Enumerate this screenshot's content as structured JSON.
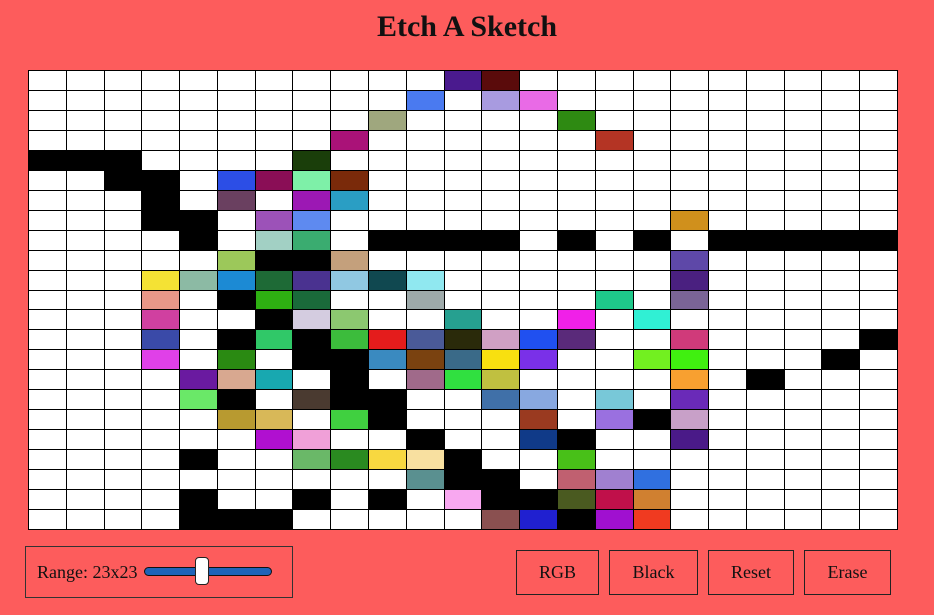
{
  "title": "Etch A Sketch",
  "range": {
    "label": "Range: 23x23",
    "value": 23,
    "min": 1,
    "max": 50
  },
  "buttons": {
    "rgb": "RGB",
    "black": "Black",
    "reset": "Reset",
    "erase": "Erase"
  },
  "grid": {
    "size": 23,
    "painted_cells": [
      [
        0,
        11,
        "#4a1a8e"
      ],
      [
        0,
        12,
        "#5a0b0b"
      ],
      [
        1,
        10,
        "#4a7af0"
      ],
      [
        1,
        12,
        "#a89be0"
      ],
      [
        1,
        13,
        "#e96ae6"
      ],
      [
        2,
        9,
        "#9fa77e"
      ],
      [
        2,
        14,
        "#2e8a12"
      ],
      [
        3,
        8,
        "#aa1278"
      ],
      [
        3,
        15,
        "#b43424"
      ],
      [
        4,
        0,
        "#000000"
      ],
      [
        4,
        1,
        "#000000"
      ],
      [
        4,
        2,
        "#000000"
      ],
      [
        4,
        7,
        "#1a3e0a"
      ],
      [
        5,
        2,
        "#000000"
      ],
      [
        5,
        3,
        "#000000"
      ],
      [
        5,
        5,
        "#2c4ee6"
      ],
      [
        5,
        6,
        "#8a0e56"
      ],
      [
        5,
        7,
        "#7ef0a8"
      ],
      [
        5,
        8,
        "#7a2a0a"
      ],
      [
        6,
        3,
        "#000000"
      ],
      [
        6,
        5,
        "#6a4060"
      ],
      [
        6,
        7,
        "#9c18b4"
      ],
      [
        6,
        8,
        "#2a9ec4"
      ],
      [
        7,
        3,
        "#000000"
      ],
      [
        7,
        4,
        "#000000"
      ],
      [
        7,
        6,
        "#9c52b8"
      ],
      [
        7,
        7,
        "#5e8af0"
      ],
      [
        7,
        17,
        "#d0901c"
      ],
      [
        8,
        4,
        "#000000"
      ],
      [
        8,
        6,
        "#a2d0c4"
      ],
      [
        8,
        7,
        "#3aac70"
      ],
      [
        8,
        9,
        "#000000"
      ],
      [
        8,
        10,
        "#000000"
      ],
      [
        8,
        11,
        "#000000"
      ],
      [
        8,
        12,
        "#000000"
      ],
      [
        8,
        14,
        "#000000"
      ],
      [
        8,
        16,
        "#000000"
      ],
      [
        8,
        18,
        "#000000"
      ],
      [
        8,
        19,
        "#000000"
      ],
      [
        8,
        20,
        "#000000"
      ],
      [
        8,
        21,
        "#000000"
      ],
      [
        8,
        22,
        "#000000"
      ],
      [
        9,
        5,
        "#9cc85a"
      ],
      [
        9,
        6,
        "#000000"
      ],
      [
        9,
        7,
        "#000000"
      ],
      [
        9,
        8,
        "#c4a07c"
      ],
      [
        9,
        17,
        "#5e48a8"
      ],
      [
        10,
        3,
        "#f4e234"
      ],
      [
        10,
        4,
        "#8cbaa4"
      ],
      [
        10,
        5,
        "#1c8ad4"
      ],
      [
        10,
        6,
        "#1e6a36"
      ],
      [
        10,
        7,
        "#4a3290"
      ],
      [
        10,
        8,
        "#90c8e2"
      ],
      [
        10,
        9,
        "#104850"
      ],
      [
        10,
        10,
        "#90e8f0"
      ],
      [
        10,
        17,
        "#4a2080"
      ],
      [
        11,
        3,
        "#e89888"
      ],
      [
        11,
        5,
        "#000000"
      ],
      [
        11,
        6,
        "#2eb012"
      ],
      [
        11,
        7,
        "#1a6a3a"
      ],
      [
        11,
        10,
        "#9eaaaa"
      ],
      [
        11,
        15,
        "#1ec88a"
      ],
      [
        11,
        17,
        "#7a6496"
      ],
      [
        12,
        3,
        "#d040a0"
      ],
      [
        12,
        6,
        "#000000"
      ],
      [
        12,
        7,
        "#d4cce0"
      ],
      [
        12,
        8,
        "#8cc870"
      ],
      [
        12,
        11,
        "#26a090"
      ],
      [
        12,
        14,
        "#f020e8"
      ],
      [
        12,
        16,
        "#30f0d4"
      ],
      [
        13,
        3,
        "#3a4aa8"
      ],
      [
        13,
        5,
        "#000000"
      ],
      [
        13,
        6,
        "#30c868"
      ],
      [
        13,
        7,
        "#000000"
      ],
      [
        13,
        8,
        "#3cbc3c"
      ],
      [
        13,
        9,
        "#e41c1c"
      ],
      [
        13,
        10,
        "#4a5a98"
      ],
      [
        13,
        11,
        "#2a2a0a"
      ],
      [
        13,
        12,
        "#d0a0c4"
      ],
      [
        13,
        13,
        "#2050f0"
      ],
      [
        13,
        14,
        "#5a2a7a"
      ],
      [
        13,
        17,
        "#d03a7a"
      ],
      [
        13,
        22,
        "#000000"
      ],
      [
        14,
        3,
        "#e040e8"
      ],
      [
        14,
        5,
        "#2a8a12"
      ],
      [
        14,
        7,
        "#000000"
      ],
      [
        14,
        8,
        "#000000"
      ],
      [
        14,
        9,
        "#3a8ac0"
      ],
      [
        14,
        10,
        "#7a4210"
      ],
      [
        14,
        11,
        "#3a6a88"
      ],
      [
        14,
        12,
        "#f8e010"
      ],
      [
        14,
        13,
        "#7a30e8"
      ],
      [
        14,
        16,
        "#72f020"
      ],
      [
        14,
        17,
        "#40f010"
      ],
      [
        14,
        21,
        "#000000"
      ],
      [
        15,
        4,
        "#6a1aa0"
      ],
      [
        15,
        5,
        "#d8a890"
      ],
      [
        15,
        6,
        "#18a8b0"
      ],
      [
        15,
        8,
        "#000000"
      ],
      [
        15,
        10,
        "#a06a8a"
      ],
      [
        15,
        11,
        "#30e040"
      ],
      [
        15,
        12,
        "#c0c040"
      ],
      [
        15,
        17,
        "#f8a030"
      ],
      [
        15,
        19,
        "#000000"
      ],
      [
        16,
        4,
        "#6ae868"
      ],
      [
        16,
        5,
        "#000000"
      ],
      [
        16,
        7,
        "#4a3a30"
      ],
      [
        16,
        8,
        "#000000"
      ],
      [
        16,
        9,
        "#000000"
      ],
      [
        16,
        12,
        "#4070a8"
      ],
      [
        16,
        13,
        "#88a8e0"
      ],
      [
        16,
        15,
        "#78c8d8"
      ],
      [
        16,
        17,
        "#6a2ab8"
      ],
      [
        17,
        5,
        "#b89a30"
      ],
      [
        17,
        6,
        "#d8b858"
      ],
      [
        17,
        8,
        "#40d040"
      ],
      [
        17,
        9,
        "#000000"
      ],
      [
        17,
        13,
        "#9a3a20"
      ],
      [
        17,
        15,
        "#9a70e0"
      ],
      [
        17,
        16,
        "#000000"
      ],
      [
        17,
        17,
        "#c8a0c8"
      ],
      [
        18,
        6,
        "#b010d0"
      ],
      [
        18,
        7,
        "#f0a0d8"
      ],
      [
        18,
        10,
        "#000000"
      ],
      [
        18,
        13,
        "#103a88"
      ],
      [
        18,
        14,
        "#000000"
      ],
      [
        18,
        17,
        "#4a1a88"
      ],
      [
        19,
        4,
        "#000000"
      ],
      [
        19,
        7,
        "#6ab868"
      ],
      [
        19,
        8,
        "#2a8a20"
      ],
      [
        19,
        9,
        "#f8d840"
      ],
      [
        19,
        10,
        "#f8e0a0"
      ],
      [
        19,
        11,
        "#000000"
      ],
      [
        19,
        14,
        "#48c018"
      ],
      [
        20,
        10,
        "#5a9090"
      ],
      [
        20,
        11,
        "#000000"
      ],
      [
        20,
        12,
        "#000000"
      ],
      [
        20,
        14,
        "#c06070"
      ],
      [
        20,
        15,
        "#a080d0"
      ],
      [
        20,
        16,
        "#3070e0"
      ],
      [
        21,
        4,
        "#000000"
      ],
      [
        21,
        7,
        "#000000"
      ],
      [
        21,
        9,
        "#000000"
      ],
      [
        21,
        11,
        "#f8a8f0"
      ],
      [
        21,
        12,
        "#000000"
      ],
      [
        21,
        13,
        "#000000"
      ],
      [
        21,
        14,
        "#4a5a20"
      ],
      [
        21,
        15,
        "#c0104a"
      ],
      [
        21,
        16,
        "#d08030"
      ],
      [
        22,
        4,
        "#000000"
      ],
      [
        22,
        5,
        "#000000"
      ],
      [
        22,
        6,
        "#000000"
      ],
      [
        22,
        12,
        "#8a5050"
      ],
      [
        22,
        13,
        "#2020d0"
      ],
      [
        22,
        14,
        "#000000"
      ],
      [
        22,
        15,
        "#a010d0"
      ],
      [
        22,
        16,
        "#f03a20"
      ]
    ]
  }
}
